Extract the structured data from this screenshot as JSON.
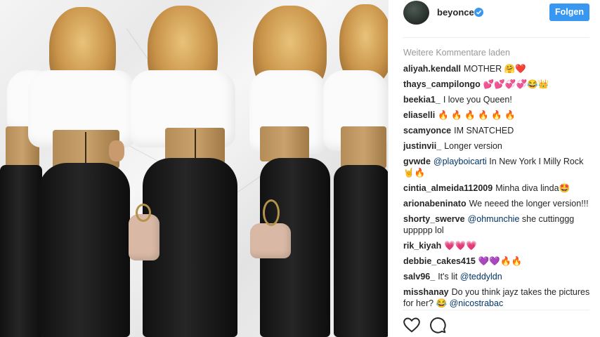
{
  "post": {
    "username": "beyonce",
    "follow_label": "Folgen",
    "load_more_label": "Weitere Kommentare laden",
    "colors": {
      "follow_button": "#3897f0",
      "verified_badge": "#3897f0",
      "mention": "#003569"
    },
    "icons": [
      "verified-badge-icon",
      "heart-icon",
      "comment-icon"
    ]
  },
  "comments": [
    {
      "user": "aliyah.kendall",
      "text": "MOTHER 🤗❤️"
    },
    {
      "user": "thays_campilongo",
      "text": "💕💕💞💞😂👑"
    },
    {
      "user": "beekia1_",
      "text": "I love you Queen!"
    },
    {
      "user": "eliaselli",
      "text": "🔥 🔥 🔥 🔥 🔥 🔥"
    },
    {
      "user": "scamyonce",
      "text": "IM SNATCHED"
    },
    {
      "user": "justinvii_",
      "text": "Longer version"
    },
    {
      "user": "gvwde",
      "mention": "@playboicarti",
      "text": " In New York I Milly Rock 🤘🔥"
    },
    {
      "user": "cintia_almeida112009",
      "text": "Minha diva linda🤩"
    },
    {
      "user": "arionabeninato",
      "text": "We neeed the longer version!!!"
    },
    {
      "user": "shorty_swerve",
      "mention": "@ohmunchie",
      "text": " she cuttinggg uppppp lol"
    },
    {
      "user": "rik_kiyah",
      "text": "💗💗💗"
    },
    {
      "user": "debbie_cakes415",
      "text": "💜💜🔥🔥"
    },
    {
      "user": "salv96_",
      "text": "It's lit ",
      "mention_after": "@teddyldn"
    },
    {
      "user": "misshanay",
      "text": "Do you think jayz takes the pictures for her? 😂 ",
      "mention_after": "@nicostrabac"
    }
  ]
}
